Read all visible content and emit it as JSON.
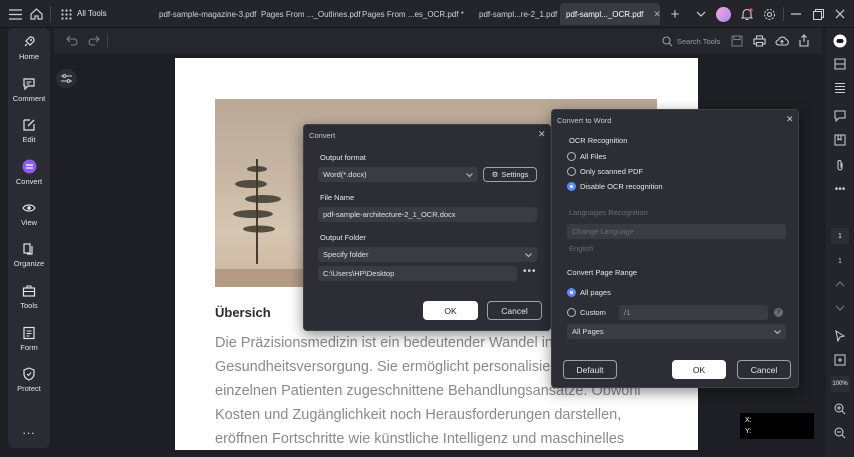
{
  "titlebar": {
    "all_tools": "All Tools",
    "tabs": [
      {
        "label": "pdf-sample-magazine-3.pdf"
      },
      {
        "label": "Pages  From ..._Outlines.pdf"
      },
      {
        "label": "Pages  From ...es_OCR.pdf *"
      },
      {
        "label": "pdf-sampl...re-2_1.pdf"
      },
      {
        "label": "pdf-sampl..._OCR.pdf"
      }
    ]
  },
  "toolbar": {
    "search_label": "Search Tools"
  },
  "sidebar": {
    "items": [
      {
        "label": "Home",
        "icon": "home-icon"
      },
      {
        "label": "Comment",
        "icon": "comment-icon"
      },
      {
        "label": "Edit",
        "icon": "edit-icon"
      },
      {
        "label": "Convert",
        "icon": "convert-icon"
      },
      {
        "label": "View",
        "icon": "eye-icon"
      },
      {
        "label": "Organize",
        "icon": "organize-icon"
      },
      {
        "label": "Tools",
        "icon": "toolbox-icon"
      },
      {
        "label": "Form",
        "icon": "form-icon"
      },
      {
        "label": "Protect",
        "icon": "shield-icon"
      }
    ],
    "more": "..."
  },
  "document": {
    "heading": "Übersich",
    "lines": [
      "Die Präzisionsmedizin ist ein bedeutender Wandel in d",
      "Gesundheitsversorgung. Sie ermöglicht personalisiert",
      "einzelnen Patienten zugeschnittene Behandlungsansätze. Obwohl",
      "Kosten und Zugänglichkeit noch Herausforderungen darstellen,",
      "eröffnen Fortschritte wie künstliche Intelligenz und maschinelles"
    ]
  },
  "convert_dialog": {
    "title": "Convert",
    "output_format_label": "Output format",
    "output_format_value": "Word(*.docx)",
    "settings_label": "Settings",
    "file_name_label": "File Name",
    "file_name_value": "pdf-sample-architecture-2_1_OCR.docx",
    "output_folder_label": "Output Folder",
    "folder_mode": "Specify folder",
    "folder_path": "C:\\Users\\HP\\Desktop",
    "ok": "OK",
    "cancel": "Cancel"
  },
  "word_dialog": {
    "title": "Convert to Word",
    "ocr_label": "OCR Recognition",
    "ocr_options": [
      "All Files",
      "Only scanned PDF",
      "Disable OCR recognition"
    ],
    "ocr_selected": 2,
    "lang_label": "Languages Recognition",
    "lang_button": "Change Language",
    "lang_value": "English",
    "range_label": "Convert Page Range",
    "all_pages": "All pages",
    "custom": "Custom",
    "custom_placeholder": "/1",
    "pages_select": "All Pages",
    "default": "Default",
    "ok": "OK",
    "cancel": "Cancel"
  },
  "right_panel": {
    "page_current": "1",
    "page_total": "1",
    "zoom": "100%"
  },
  "coords": {
    "x_label": "X:",
    "y_label": "Y:"
  }
}
